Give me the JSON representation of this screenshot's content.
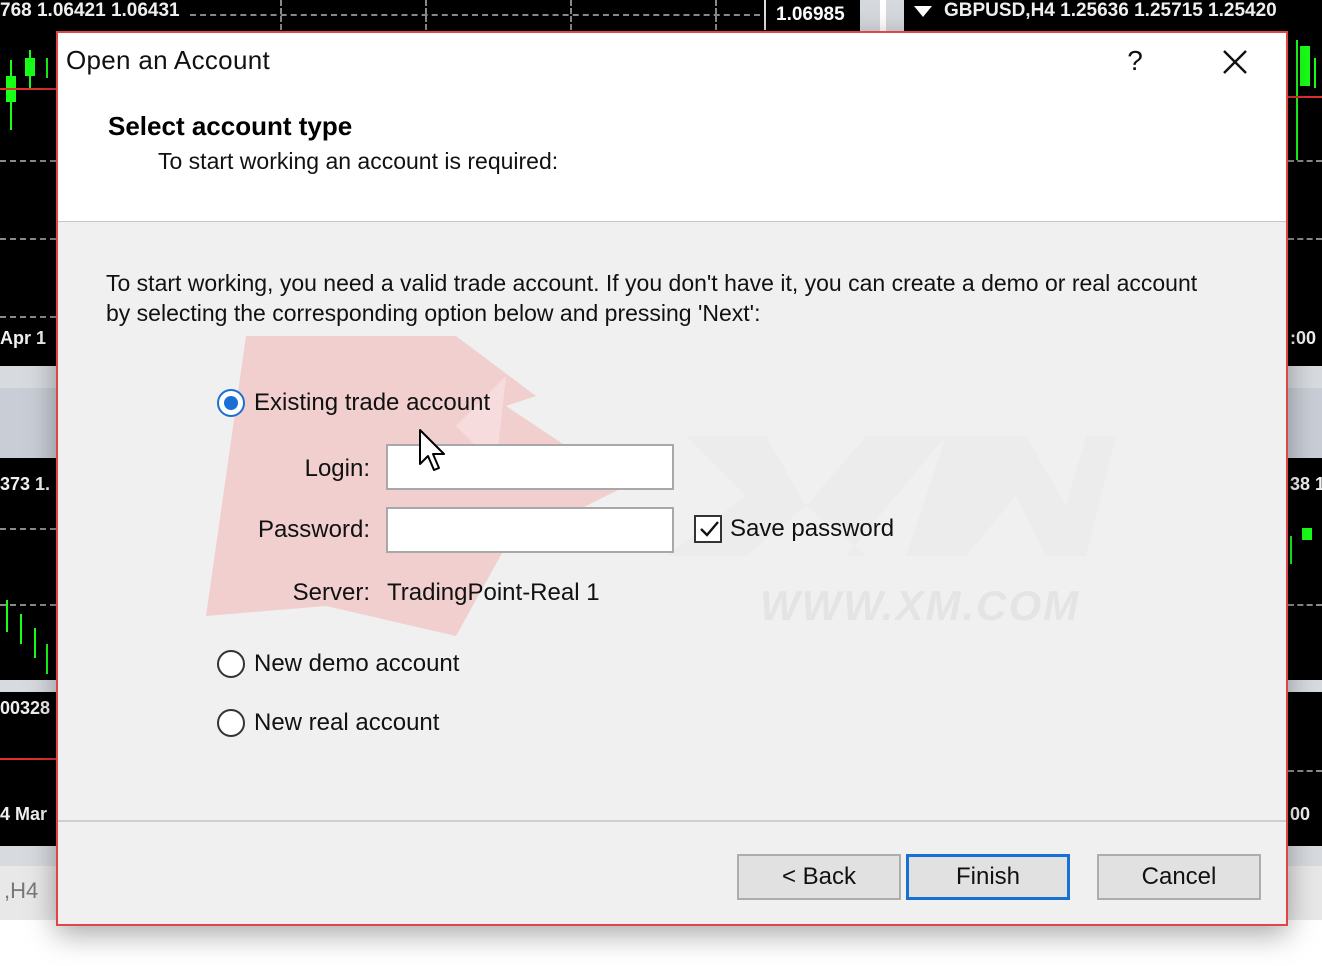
{
  "terminal": {
    "quote_left": "768 1.06421 1.06431",
    "price_tag": "1.06985",
    "quote_right": "GBPUSD,H4  1.25636 1.25715 1.25420",
    "date_left": "Apr 1",
    "time_right": ":00",
    "price_left_mid": "373 1.",
    "price_right_mid": "38 1",
    "price_left_low": "00328",
    "date_left_low": "4 Mar",
    "time_right_low": "00",
    "tab_label": ",H4"
  },
  "dialog": {
    "title": "Open an Account",
    "help": "?",
    "heading": "Select account type",
    "subheading": "To start working an account is required:",
    "intro": "To start working, you need a valid trade account. If you don't have it, you can create a demo or real account by selecting the corresponding option below and pressing 'Next':",
    "options": {
      "existing": "Existing trade account",
      "demo": "New demo account",
      "real": "New real account"
    },
    "selected_option": "existing",
    "login_label": "Login:",
    "login_value": "",
    "password_label": "Password:",
    "password_value": "",
    "save_password_label": "Save password",
    "save_password_checked": true,
    "server_label": "Server:",
    "server_value": "TradingPoint-Real 1",
    "buttons": {
      "back": "< Back",
      "finish": "Finish",
      "cancel": "Cancel"
    },
    "watermark_text": "WWW.XM.COM"
  },
  "colors": {
    "dialog_border": "#e0454a",
    "accent": "#1a6fd4",
    "candle": "#18ff18",
    "watermark": "#f1c9c9"
  }
}
